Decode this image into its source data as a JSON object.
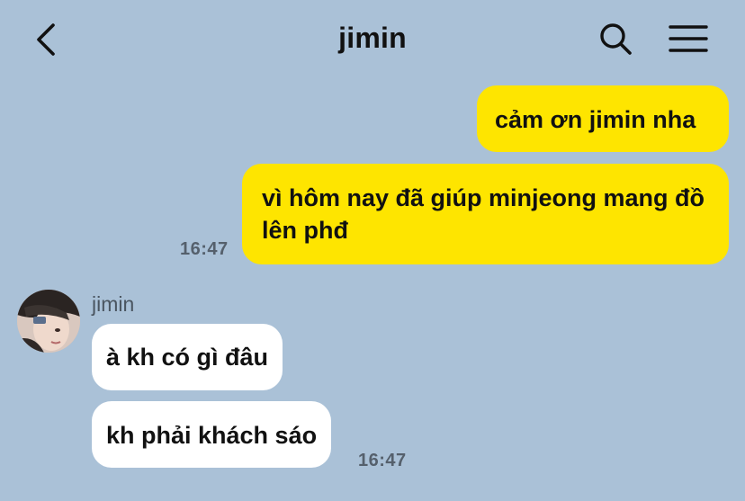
{
  "header": {
    "title": "jimin",
    "back_icon": "chevron-left-icon",
    "search_icon": "search-icon",
    "menu_icon": "hamburger-menu-icon"
  },
  "conversation": {
    "outgoing": [
      {
        "text": "cảm ơn jimin nha"
      },
      {
        "text": "vì hôm nay đã giúp minjeong mang đồ lên phđ"
      }
    ],
    "outgoing_time": "16:47",
    "incoming_sender": "jimin",
    "incoming": [
      {
        "text": "à kh có gì đâu"
      },
      {
        "text": "kh phải khách sáo"
      }
    ],
    "incoming_time": "16:47"
  },
  "colors": {
    "background": "#aac1d7",
    "outgoing_bubble": "#fee500",
    "incoming_bubble": "#ffffff"
  }
}
